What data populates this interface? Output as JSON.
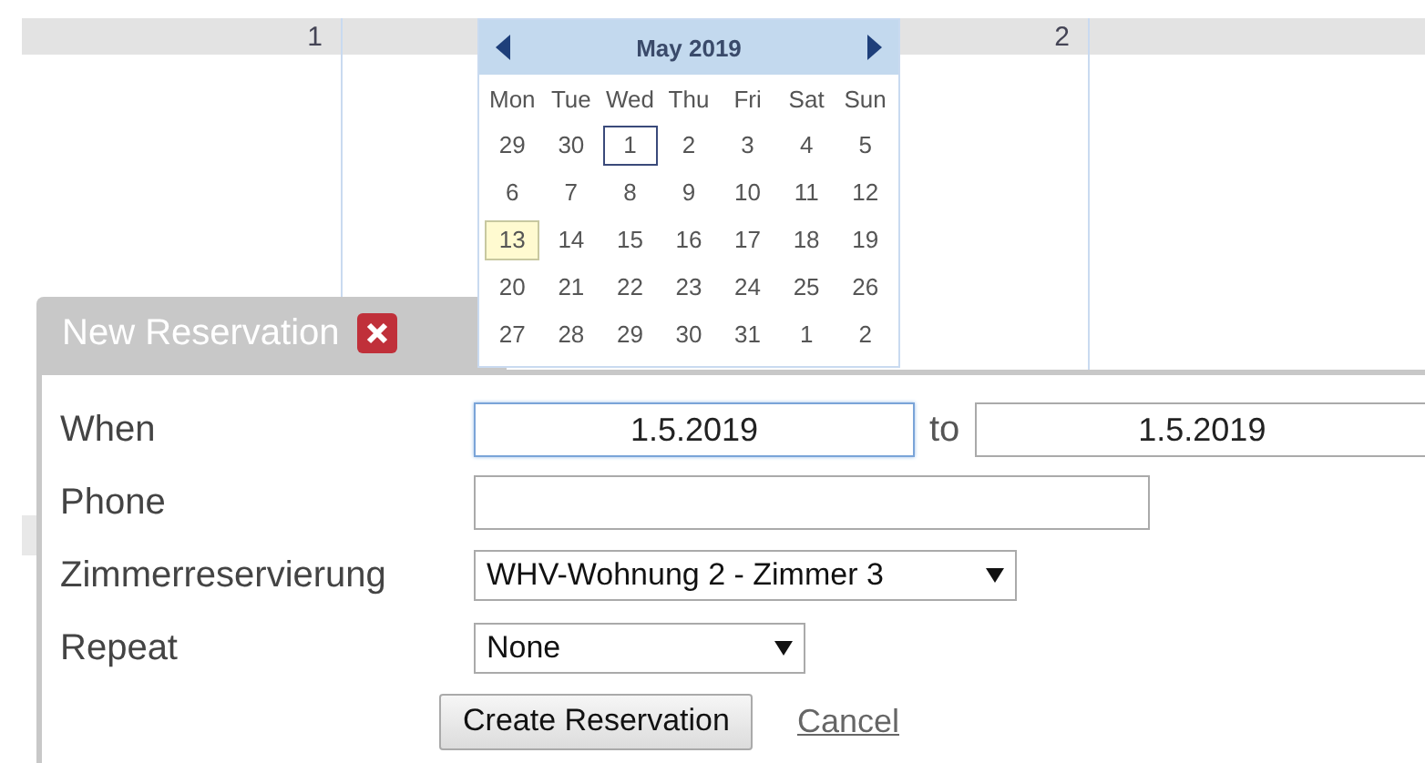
{
  "calendar": {
    "columns": [
      {
        "label": "1"
      },
      {
        "label": "2"
      }
    ]
  },
  "datepicker": {
    "month_label": "May 2019",
    "weekdays": [
      "Mon",
      "Tue",
      "Wed",
      "Thu",
      "Fri",
      "Sat",
      "Sun"
    ],
    "weeks": [
      [
        {
          "day": "29",
          "selected": false,
          "today": false
        },
        {
          "day": "30",
          "selected": false,
          "today": false
        },
        {
          "day": "1",
          "selected": true,
          "today": false
        },
        {
          "day": "2",
          "selected": false,
          "today": false
        },
        {
          "day": "3",
          "selected": false,
          "today": false
        },
        {
          "day": "4",
          "selected": false,
          "today": false
        },
        {
          "day": "5",
          "selected": false,
          "today": false
        }
      ],
      [
        {
          "day": "6",
          "selected": false,
          "today": false
        },
        {
          "day": "7",
          "selected": false,
          "today": false
        },
        {
          "day": "8",
          "selected": false,
          "today": false
        },
        {
          "day": "9",
          "selected": false,
          "today": false
        },
        {
          "day": "10",
          "selected": false,
          "today": false
        },
        {
          "day": "11",
          "selected": false,
          "today": false
        },
        {
          "day": "12",
          "selected": false,
          "today": false
        }
      ],
      [
        {
          "day": "13",
          "selected": false,
          "today": true
        },
        {
          "day": "14",
          "selected": false,
          "today": false
        },
        {
          "day": "15",
          "selected": false,
          "today": false
        },
        {
          "day": "16",
          "selected": false,
          "today": false
        },
        {
          "day": "17",
          "selected": false,
          "today": false
        },
        {
          "day": "18",
          "selected": false,
          "today": false
        },
        {
          "day": "19",
          "selected": false,
          "today": false
        }
      ],
      [
        {
          "day": "20",
          "selected": false,
          "today": false
        },
        {
          "day": "21",
          "selected": false,
          "today": false
        },
        {
          "day": "22",
          "selected": false,
          "today": false
        },
        {
          "day": "23",
          "selected": false,
          "today": false
        },
        {
          "day": "24",
          "selected": false,
          "today": false
        },
        {
          "day": "25",
          "selected": false,
          "today": false
        },
        {
          "day": "26",
          "selected": false,
          "today": false
        }
      ],
      [
        {
          "day": "27",
          "selected": false,
          "today": false
        },
        {
          "day": "28",
          "selected": false,
          "today": false
        },
        {
          "day": "29",
          "selected": false,
          "today": false
        },
        {
          "day": "30",
          "selected": false,
          "today": false
        },
        {
          "day": "31",
          "selected": false,
          "today": false
        },
        {
          "day": "1",
          "selected": false,
          "today": false
        },
        {
          "day": "2",
          "selected": false,
          "today": false
        }
      ]
    ]
  },
  "dialog": {
    "title": "New Reservation",
    "when": {
      "label": "When",
      "from": "1.5.2019",
      "separator": "to",
      "to": "1.5.2019"
    },
    "phone": {
      "label": "Phone"
    },
    "room": {
      "label": "Zimmerreservierung",
      "value": "WHV-Wohnung 2 - Zimmer 3"
    },
    "repeat": {
      "label": "Repeat",
      "value": "None"
    },
    "submit": "Create Reservation",
    "cancel": "Cancel"
  }
}
